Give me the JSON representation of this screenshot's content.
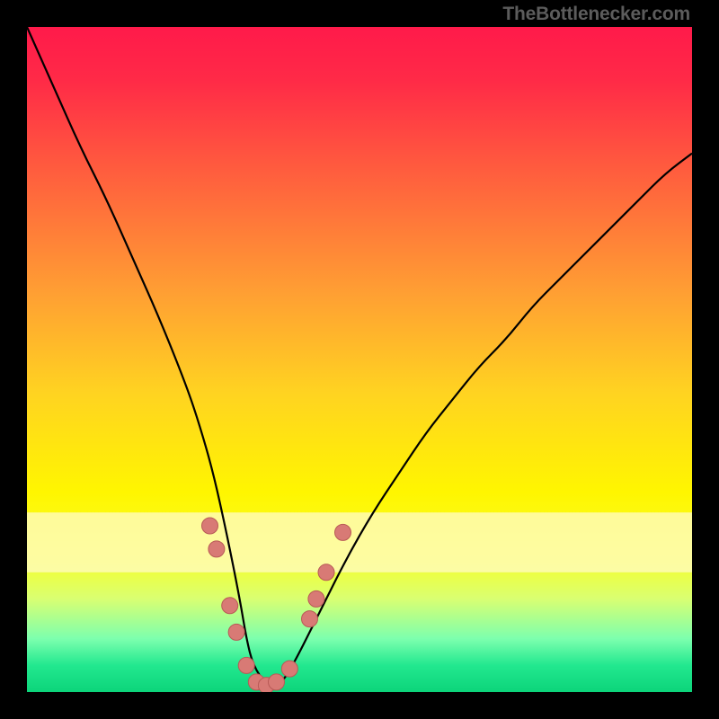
{
  "watermark": {
    "text": "TheBottlenecker.com"
  },
  "colors": {
    "gradient_stops": [
      {
        "offset": 0.0,
        "color": "#ff1a4a"
      },
      {
        "offset": 0.08,
        "color": "#ff2a47"
      },
      {
        "offset": 0.2,
        "color": "#ff573f"
      },
      {
        "offset": 0.4,
        "color": "#ff9f33"
      },
      {
        "offset": 0.55,
        "color": "#ffd321"
      },
      {
        "offset": 0.7,
        "color": "#fff600"
      },
      {
        "offset": 0.8,
        "color": "#f7ff2b"
      },
      {
        "offset": 0.86,
        "color": "#d9ff72"
      },
      {
        "offset": 0.92,
        "color": "#7cffae"
      },
      {
        "offset": 0.96,
        "color": "#22e88f"
      },
      {
        "offset": 1.0,
        "color": "#0cd47a"
      }
    ],
    "optimal_band": "#fffbc2",
    "curve": "#000000",
    "marker_fill": "#d87a75",
    "marker_stroke": "#b85a56"
  },
  "chart_data": {
    "type": "line",
    "title": "",
    "xlabel": "",
    "ylabel": "",
    "xlim": [
      0,
      100
    ],
    "ylim": [
      0,
      100
    ],
    "optimal_band_y": [
      73,
      82
    ],
    "series": [
      {
        "name": "bottleneck-curve",
        "x": [
          0,
          4,
          8,
          12,
          16,
          20,
          24,
          26,
          28,
          30,
          32,
          33,
          34,
          36,
          38,
          40,
          44,
          48,
          52,
          56,
          60,
          64,
          68,
          72,
          76,
          80,
          84,
          88,
          92,
          96,
          100
        ],
        "y": [
          0,
          9,
          18,
          26,
          35,
          44,
          54,
          60,
          67,
          76,
          86,
          92,
          96,
          99,
          99,
          96,
          88,
          80,
          73,
          67,
          61,
          56,
          51,
          47,
          42,
          38,
          34,
          30,
          26,
          22,
          19
        ]
      }
    ],
    "markers": {
      "name": "data-points",
      "points": [
        {
          "x": 27.5,
          "y": 75
        },
        {
          "x": 28.5,
          "y": 78.5
        },
        {
          "x": 30.5,
          "y": 87
        },
        {
          "x": 31.5,
          "y": 91
        },
        {
          "x": 33.0,
          "y": 96
        },
        {
          "x": 34.5,
          "y": 98.5
        },
        {
          "x": 36.0,
          "y": 99
        },
        {
          "x": 37.5,
          "y": 98.5
        },
        {
          "x": 39.5,
          "y": 96.5
        },
        {
          "x": 42.5,
          "y": 89
        },
        {
          "x": 43.5,
          "y": 86
        },
        {
          "x": 45.0,
          "y": 82
        },
        {
          "x": 47.5,
          "y": 76
        }
      ]
    }
  }
}
